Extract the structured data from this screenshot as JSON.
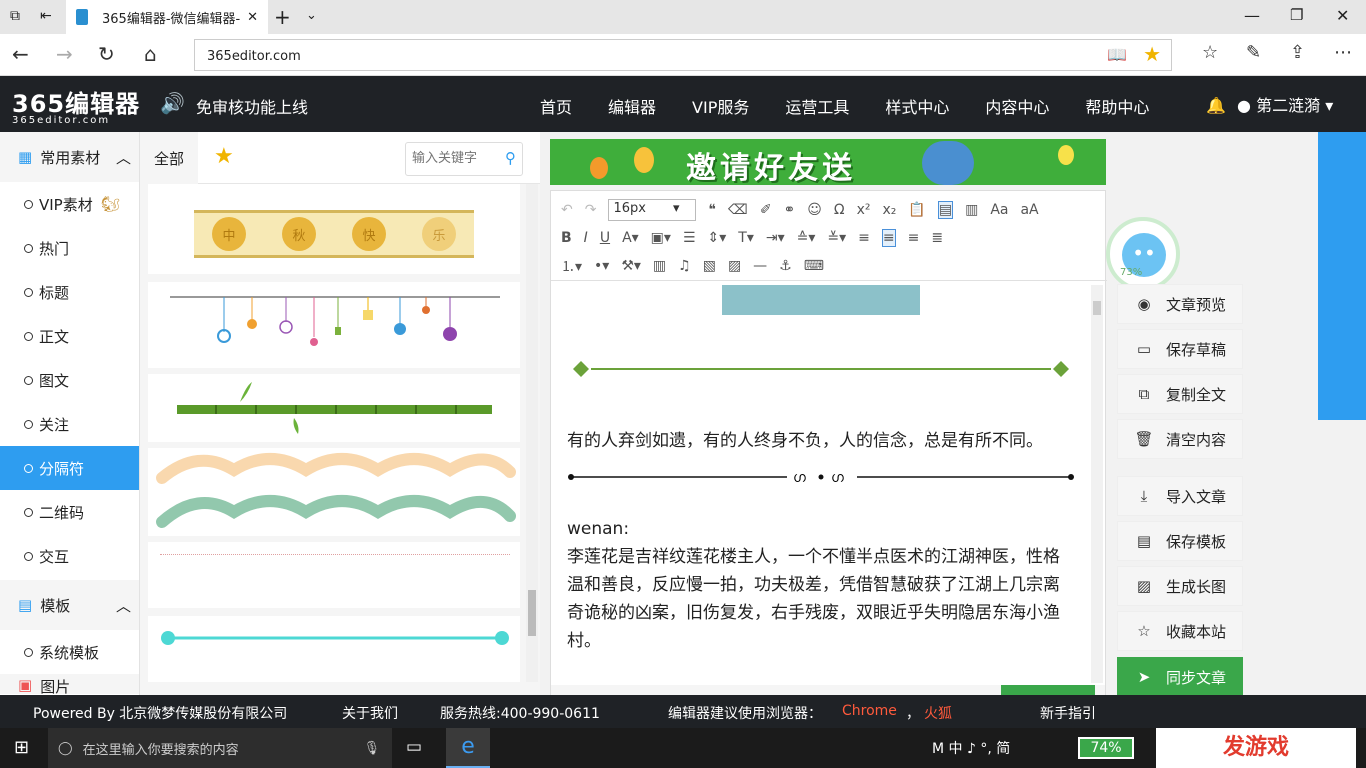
{
  "browser": {
    "tab_title": "365编辑器-微信编辑器-",
    "url": "365editor.com"
  },
  "site": {
    "logo_text": "365编辑器",
    "logo_sub": "365editor.com",
    "announcement": "免审核功能上线",
    "nav": [
      "首页",
      "编辑器",
      "VIP服务",
      "运营工具",
      "样式中心",
      "内容中心",
      "帮助中心"
    ],
    "username": "第二涟漪"
  },
  "sidebar": {
    "cat1": "常用素材",
    "items": [
      "VIP素材",
      "热门",
      "标题",
      "正文",
      "图文",
      "关注",
      "分隔符",
      "二维码",
      "交互"
    ],
    "active_index": 6,
    "cat2": "模板",
    "cat2_items": [
      "系统模板"
    ],
    "cat3": "图片"
  },
  "materials": {
    "tab_all": "全部",
    "search_placeholder": "输入关键字",
    "mooncake_chars": [
      "中",
      "秋",
      "快",
      "乐"
    ]
  },
  "banner": {
    "text": "邀请好友送"
  },
  "editor": {
    "font_size": "16px",
    "paragraph1": "有的人弃剑如遗，有的人终身不负，人的信念，总是有所不同。",
    "label": "wenan:",
    "paragraph2": "李莲花是吉祥纹莲花楼主人，一个不懂半点医术的江湖神医，性格温和善良，反应慢一拍，功夫极差，凭借智慧破获了江湖上几宗离奇诡秘的凶案，旧伤复发，右手残废，双眼近乎失明隐居东海小渔村。"
  },
  "float_widget": {
    "percent": "73%"
  },
  "actions": [
    "文章预览",
    "保存草稿",
    "复制全文",
    "清空内容",
    "导入文章",
    "保存模板",
    "生成长图",
    "收藏本站"
  ],
  "sync_button": "同步文章",
  "footer": {
    "powered": "Powered By 北京微梦传媒股份有限公司",
    "about": "关于我们",
    "hotline": "服务热线:400-990-0611",
    "browser_hint": "编辑器建议使用浏览器：",
    "chrome": "Chrome",
    "sep": "，",
    "firefox": "火狐",
    "guide": "新手指引"
  },
  "taskbar": {
    "search_placeholder": "在这里输入你要搜索的内容",
    "ime": "M 中 ♪ °, 简",
    "battery": "74%",
    "watermark": "发游戏"
  },
  "colors": {
    "accent_blue": "#2e9df0",
    "header_dark": "#1f2226",
    "sync_green": "#3aa74a",
    "banner_green": "#3fae3b"
  }
}
